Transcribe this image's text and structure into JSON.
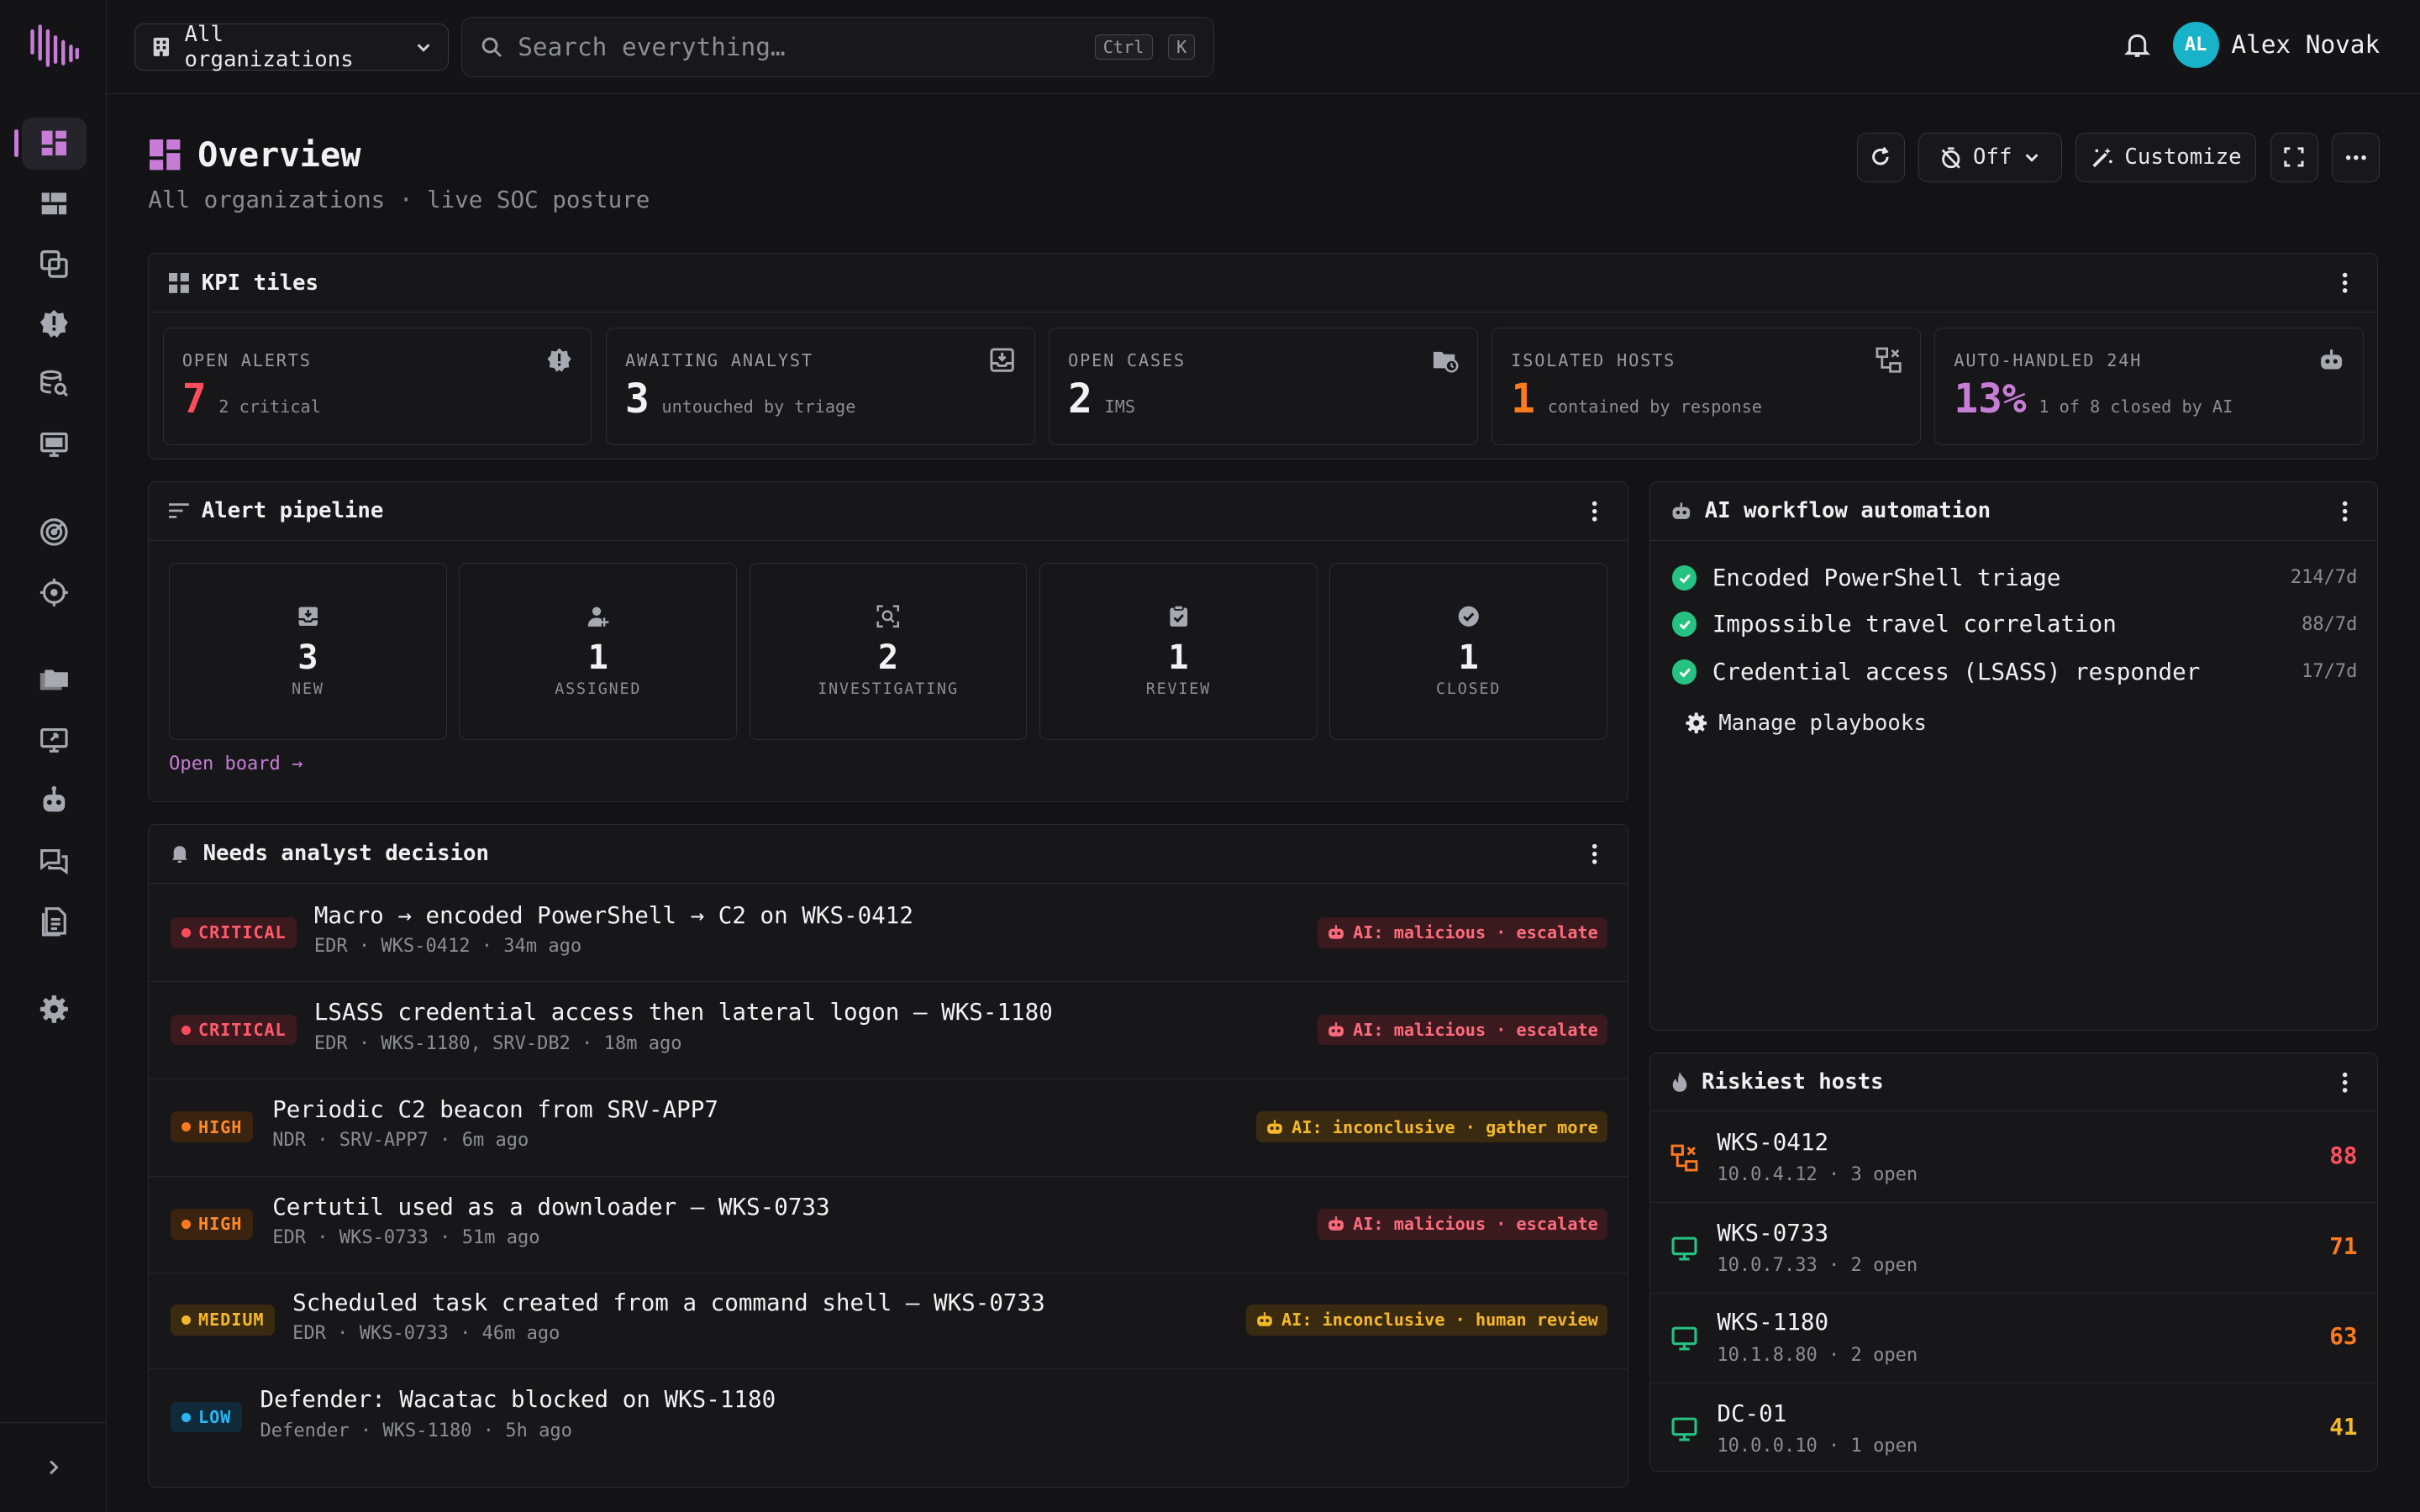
{
  "topbar": {
    "org_select": "All organizations",
    "search_placeholder": "Search everything…",
    "shortcut_ctrl": "Ctrl",
    "shortcut_k": "K",
    "user_initials": "AL",
    "user_name": "Alex Novak"
  },
  "page": {
    "title": "Overview",
    "subtitle": "All organizations · live SOC posture",
    "auto_refresh": "Off",
    "customize": "Customize"
  },
  "kpi": {
    "title": "KPI tiles",
    "tiles": [
      {
        "label": "OPEN ALERTS",
        "value": "7",
        "sub": "2 critical",
        "color": "#ff4d5e"
      },
      {
        "label": "AWAITING ANALYST",
        "value": "3",
        "sub": "untouched by triage",
        "color": "#f2f2f4"
      },
      {
        "label": "OPEN CASES",
        "value": "2",
        "sub": "IMS",
        "color": "#f2f2f4"
      },
      {
        "label": "ISOLATED HOSTS",
        "value": "1",
        "sub": "contained by response",
        "color": "#ff7a1a"
      },
      {
        "label": "AUTO-HANDLED 24H",
        "value": "13%",
        "sub": "1 of 8 closed by AI",
        "color": "#c77dd6"
      }
    ]
  },
  "pipeline": {
    "title": "Alert pipeline",
    "stages": [
      {
        "count": "3",
        "label": "NEW"
      },
      {
        "count": "1",
        "label": "ASSIGNED"
      },
      {
        "count": "2",
        "label": "INVESTIGATING"
      },
      {
        "count": "1",
        "label": "REVIEW"
      },
      {
        "count": "1",
        "label": "CLOSED"
      }
    ],
    "link": "Open board →"
  },
  "decisions": {
    "title": "Needs analyst decision",
    "alerts": [
      {
        "severity": "CRITICAL",
        "title": "Macro → encoded PowerShell → C2 on WKS-0412",
        "meta": "EDR · WKS-0412 · 34m ago",
        "ai": "AI: malicious · escalate"
      },
      {
        "severity": "CRITICAL",
        "title": "LSASS credential access then lateral logon — WKS-1180",
        "meta": "EDR · WKS-1180, SRV-DB2 · 18m ago",
        "ai": "AI: malicious · escalate"
      },
      {
        "severity": "HIGH",
        "title": "Periodic C2 beacon from SRV-APP7",
        "meta": "NDR · SRV-APP7 · 6m ago",
        "ai": "AI: inconclusive · gather more"
      },
      {
        "severity": "HIGH",
        "title": "Certutil used as a downloader — WKS-0733",
        "meta": "EDR · WKS-0733 · 51m ago",
        "ai": "AI: malicious · escalate"
      },
      {
        "severity": "MEDIUM",
        "title": "Scheduled task created from a command shell — WKS-0733",
        "meta": "EDR · WKS-0733 · 46m ago",
        "ai": "AI: inconclusive · human review"
      },
      {
        "severity": "LOW",
        "title": "Defender: Wacatac blocked on WKS-1180",
        "meta": "Defender · WKS-1180 · 5h ago",
        "ai": ""
      }
    ]
  },
  "workflow": {
    "title": "AI workflow automation",
    "items": [
      {
        "name": "Encoded PowerShell triage",
        "count": "214/7d"
      },
      {
        "name": "Impossible travel correlation",
        "count": "88/7d"
      },
      {
        "name": "Credential access (LSASS) responder",
        "count": "17/7d"
      }
    ],
    "manage": "Manage playbooks"
  },
  "hosts": {
    "title": "Riskiest hosts",
    "items": [
      {
        "name": "WKS-0412",
        "meta": "10.0.4.12 · 3 open",
        "score": "88",
        "color": "#ff4d5e",
        "icon": "isolated-host-icon"
      },
      {
        "name": "WKS-0733",
        "meta": "10.0.7.33 · 2 open",
        "score": "71",
        "color": "#ff7a1a",
        "icon": "monitor-icon"
      },
      {
        "name": "WKS-1180",
        "meta": "10.1.8.80 · 2 open",
        "score": "63",
        "color": "#ff7a1a",
        "icon": "monitor-icon"
      },
      {
        "name": "DC-01",
        "meta": "10.0.0.10 · 1 open",
        "score": "41",
        "color": "#f5b82a",
        "icon": "monitor-icon"
      }
    ]
  }
}
